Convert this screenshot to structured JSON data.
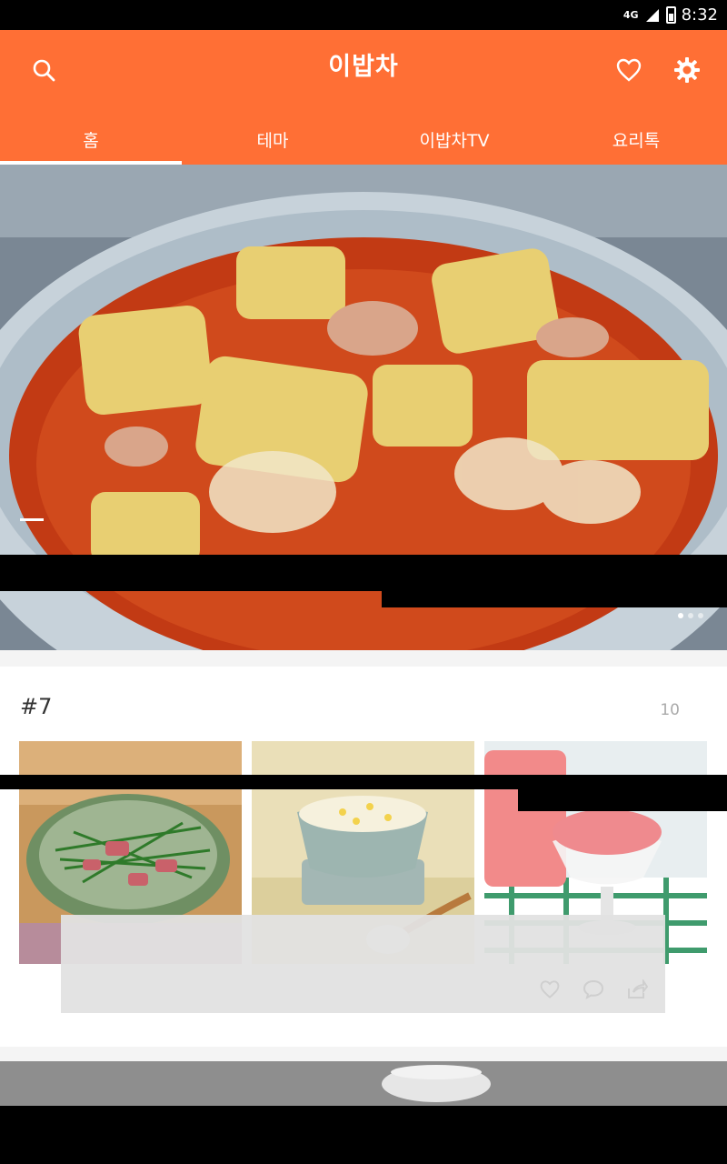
{
  "status": {
    "network": "4G",
    "time": "8:32"
  },
  "appbar": {
    "title": "이밥차",
    "tabs": [
      "홈",
      "테마",
      "이밥차TV",
      "요리톡"
    ],
    "active_tab": 0
  },
  "hero": {
    "page_count": 3,
    "active_page": 0
  },
  "card": {
    "number": "#7",
    "count": "10"
  },
  "colors": {
    "brand": "#ff6f35",
    "status_bg": "#000000"
  },
  "icons": [
    "search-icon",
    "heart-icon",
    "gear-icon",
    "like-icon",
    "comment-icon",
    "share-icon"
  ]
}
